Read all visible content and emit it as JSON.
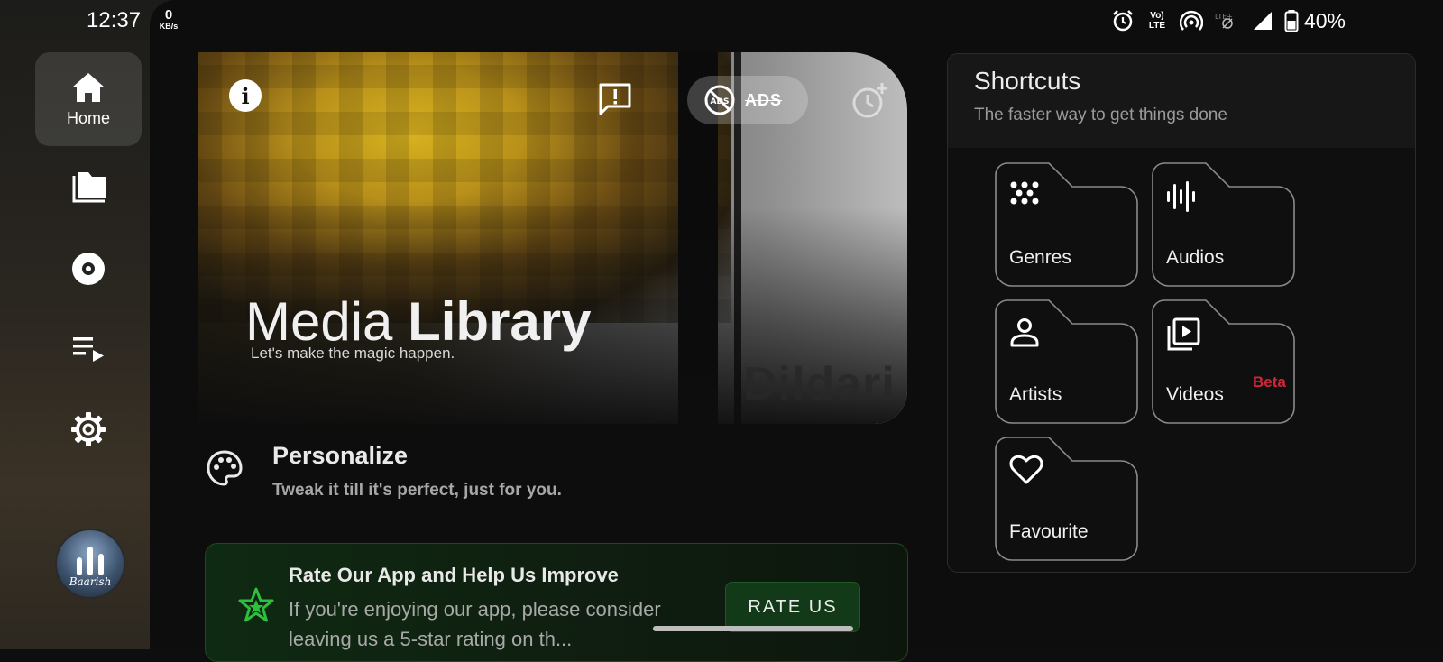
{
  "status_bar": {
    "time": "12:37",
    "net_speed_value": "0",
    "net_speed_unit": "KB/s",
    "lte_label": "Vo) LTE",
    "battery_percent": "40%"
  },
  "nav": {
    "home_label": "Home"
  },
  "avatar": {
    "caption": "Baarish"
  },
  "hero": {
    "title_light": "Media",
    "title_bold": "Library",
    "subtitle": "Let's make the magic happen.",
    "info_glyph": "i",
    "ads_label": "ADS",
    "ads_badge": "ADS",
    "watermark": "Dildari"
  },
  "personalize": {
    "title": "Personalize",
    "subtitle": "Tweak it till it's perfect, just for you."
  },
  "rate_card": {
    "title": "Rate Our App and Help Us Improve",
    "body": "If you're enjoying our app, please consider leaving us a 5-star rating on th...",
    "button_label": "RATE US"
  },
  "shortcuts": {
    "title": "Shortcuts",
    "subtitle": "The faster way to get things done",
    "tiles": [
      {
        "label": "Genres",
        "icon": "genres-dots-icon"
      },
      {
        "label": "Audios",
        "icon": "waveform-icon"
      },
      {
        "label": "Artists",
        "icon": "person-icon"
      },
      {
        "label": "Videos",
        "icon": "video-library-icon",
        "badge": "Beta"
      },
      {
        "label": "Favourite",
        "icon": "heart-icon"
      }
    ]
  },
  "colors": {
    "accent_green": "#1d5a25",
    "beta_red": "#d0273a"
  }
}
